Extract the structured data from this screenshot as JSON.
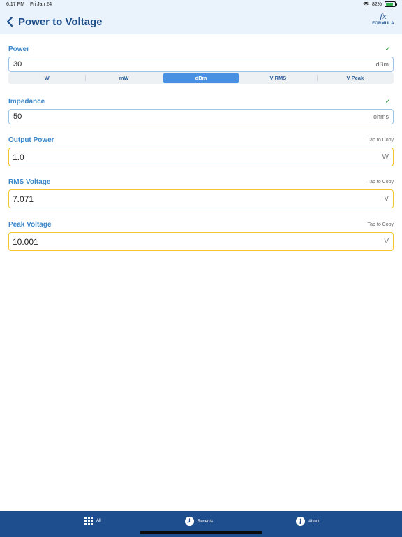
{
  "status_bar": {
    "time": "6:17 PM",
    "date": "Fri Jan 24",
    "battery_percent": "82%",
    "battery_level": 0.82
  },
  "nav": {
    "title": "Power to Voltage",
    "formula_label": "FORMULA",
    "formula_glyph": "fx"
  },
  "power": {
    "label": "Power",
    "value": "30",
    "unit": "dBm",
    "units": [
      "W",
      "mW",
      "dBm",
      "V RMS",
      "V Peak"
    ],
    "selected_unit": "dBm"
  },
  "impedance": {
    "label": "Impedance",
    "value": "50",
    "unit": "ohms"
  },
  "outputs": [
    {
      "label": "Output Power",
      "value": "1.0",
      "unit": "W",
      "hint": "Tap to Copy"
    },
    {
      "label": "RMS Voltage",
      "value": "7.071",
      "unit": "V",
      "hint": "Tap to Copy"
    },
    {
      "label": "Peak Voltage",
      "value": "10.001",
      "unit": "V",
      "hint": "Tap to Copy"
    }
  ],
  "tab_bar": {
    "tabs": [
      {
        "label": "All",
        "icon": "grid-icon"
      },
      {
        "label": "Recents",
        "icon": "clock-icon"
      },
      {
        "label": "About",
        "icon": "info-icon"
      }
    ]
  },
  "colors": {
    "accent": "#3a86c8",
    "title": "#1d4e8a",
    "segment_active": "#4a90e2",
    "output_border": "#f3c531",
    "tab_bar": "#1f4e8f",
    "check": "#2e9e3a"
  }
}
